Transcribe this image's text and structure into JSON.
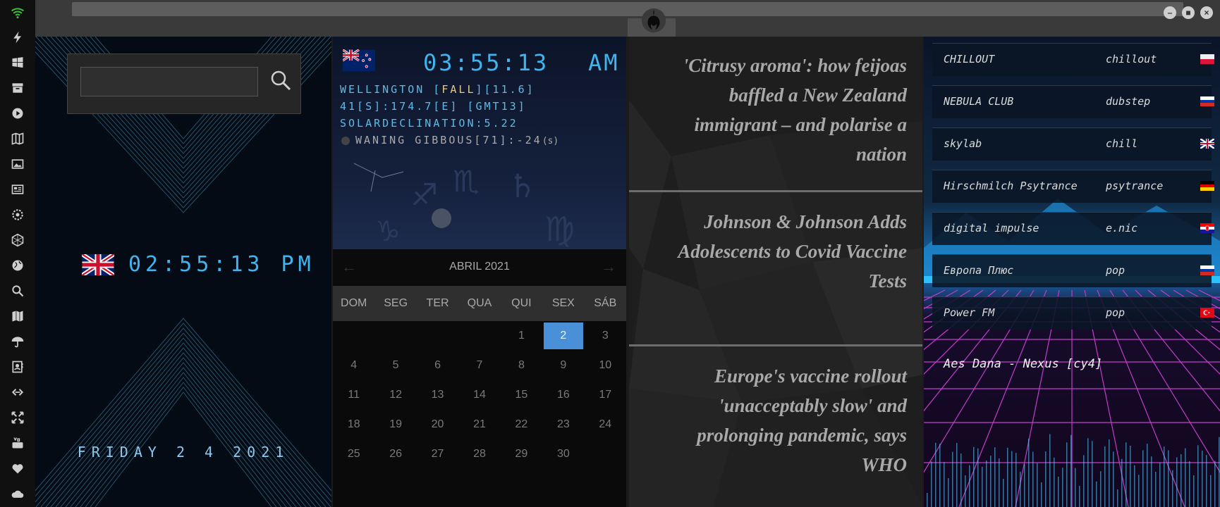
{
  "window": {
    "controls": {
      "minimize": "–",
      "maximize": "■",
      "close": "×"
    }
  },
  "rail": {
    "icons": [
      "wifi-icon",
      "bolt-icon",
      "windows-icon",
      "archive-icon",
      "play-icon",
      "map-book-icon",
      "image-icon",
      "news-icon",
      "cog-icon",
      "hexagon-icon",
      "globe-icon",
      "search-icon",
      "map-icon",
      "umbrella-icon",
      "contacts-icon",
      "link-icon",
      "expand-icon",
      "youtube-icon",
      "heart-icon",
      "cloud-icon"
    ],
    "accent": "#3fbf3f"
  },
  "clock_uk": {
    "time": "02:55:13 PM",
    "date": "FRIDAY 2 4 2021"
  },
  "search": {
    "placeholder": "",
    "value": ""
  },
  "clock_nz": {
    "time": "03:55:13",
    "ampm": "AM",
    "line1_a": "WELLINGTON [",
    "line1_b": "FALL",
    "line1_c": "][11.6]",
    "line2": "41[S]:174.7[E] [GMT13]",
    "line3": "SOLARDECLINATION:5.22",
    "line4": "WANING GIBBOUS[71]:-24",
    "line4_unit": "(s)"
  },
  "calendar": {
    "title": "ABRIL 2021",
    "prev": "←",
    "next": "→",
    "weekdays": [
      "DOM",
      "SEG",
      "TER",
      "QUA",
      "QUI",
      "SEX",
      "SÁB"
    ],
    "days": [
      "",
      "",
      "",
      "",
      "1",
      "2",
      "3",
      "4",
      "5",
      "6",
      "7",
      "8",
      "9",
      "10",
      "11",
      "12",
      "13",
      "14",
      "15",
      "16",
      "17",
      "18",
      "19",
      "20",
      "21",
      "22",
      "23",
      "24",
      "25",
      "26",
      "27",
      "28",
      "29",
      "30"
    ],
    "today": "2",
    "today_color": "#4a90d9"
  },
  "news": [
    {
      "title": "'Citrusy aroma': how feijoas baffled a New Zealand immigrant – and polarise a nation"
    },
    {
      "title": "Johnson & Johnson Adds Adolescents to Covid Vaccine Tests"
    },
    {
      "title": "Europe's vaccine rollout 'unacceptably slow' and prolonging pandemic, says WHO"
    }
  ],
  "radio": {
    "stations": [
      {
        "name": "CHILLOUT",
        "genre": "chillout",
        "flag": "poland-flag"
      },
      {
        "name": "NEBULA CLUB",
        "genre": "dubstep",
        "flag": "russia-flag"
      },
      {
        "name": "skylab",
        "genre": "chill",
        "flag": "uk-flag"
      },
      {
        "name": "Hirschmilch Psytrance",
        "genre": "psytrance",
        "flag": "germany-flag"
      },
      {
        "name": "digital impulse",
        "genre": "e.nic",
        "flag": "croatia-flag"
      },
      {
        "name": "Европа Плюс",
        "genre": "pop",
        "flag": "russia-flag"
      },
      {
        "name": "Power FM",
        "genre": "pop",
        "flag": "turkey-flag"
      }
    ],
    "now_playing": "Aes Dana - Nexus [cy4]"
  }
}
